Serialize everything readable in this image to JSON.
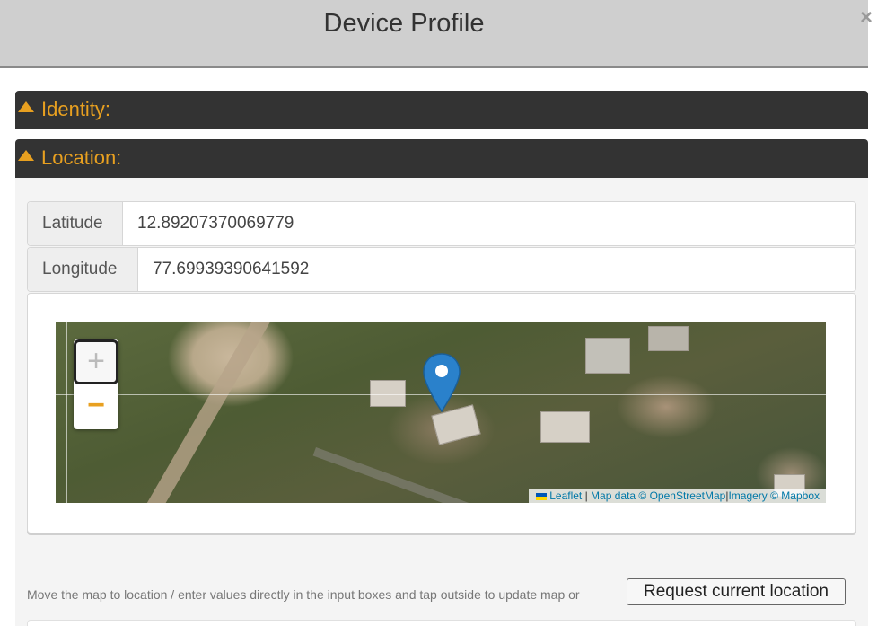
{
  "dialog": {
    "title": "Device Profile",
    "close_glyph": "×"
  },
  "sections": {
    "identity_label": "Identity:",
    "location_label": "Location:"
  },
  "location": {
    "latitude_label": "Latitude",
    "latitude_value": "12.89207370069779",
    "longitude_label": "Longitude",
    "longitude_value": "77.69939390641592"
  },
  "map": {
    "zoom_in_glyph": "+",
    "zoom_out_glyph": "−",
    "attribution": {
      "leaflet": "Leaflet",
      "separator": " | ",
      "map_data": "Map data © OpenStreetMap",
      "imagery": "Imagery © Mapbox"
    },
    "marker_icon": "map-pin-icon",
    "colors": {
      "accent": "#e8a020",
      "marker": "#2a81cb",
      "link": "#0078a8"
    }
  },
  "footer": {
    "help_text": "Move the map to location / enter values directly in the input boxes and tap outside to update map or",
    "request_button": "Request current location"
  },
  "colors": {
    "section_bar": "#333333",
    "header_bg": "#cfcfcf"
  }
}
